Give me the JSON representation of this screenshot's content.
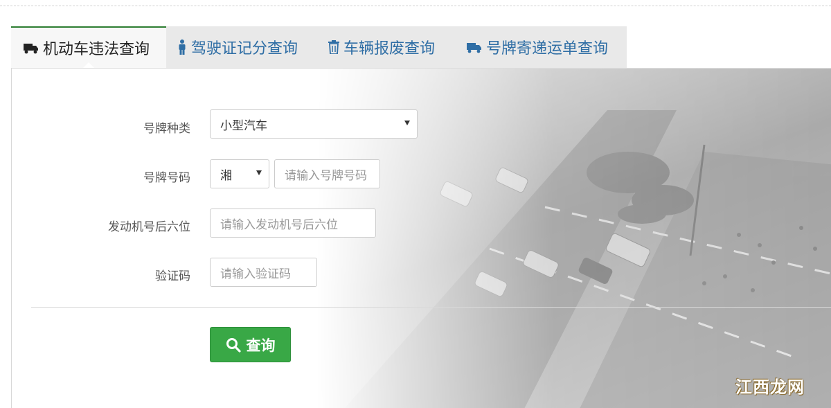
{
  "tabs": [
    {
      "label": "机动车违法查询",
      "icon": "truck-icon",
      "active": true
    },
    {
      "label": "驾驶证记分查询",
      "icon": "person-icon",
      "active": false
    },
    {
      "label": "车辆报废查询",
      "icon": "trash-icon",
      "active": false
    },
    {
      "label": "号牌寄递运单查询",
      "icon": "truck-icon",
      "active": false
    }
  ],
  "form": {
    "plate_type": {
      "label": "号牌种类",
      "selected": "小型汽车"
    },
    "plate_number": {
      "label": "号牌号码",
      "province": "湘",
      "placeholder": "请输入号牌号码"
    },
    "engine_number": {
      "label": "发动机号后六位",
      "placeholder": "请输入发动机号后六位"
    },
    "captcha": {
      "label": "验证码",
      "placeholder": "请输入验证码"
    }
  },
  "query_button": {
    "label": "查询",
    "icon": "search-icon"
  },
  "watermark": "江西龙网",
  "colors": {
    "accent_green": "#39a846",
    "tab_link": "#2f6ea5",
    "active_tab_border": "#2e7d32"
  }
}
